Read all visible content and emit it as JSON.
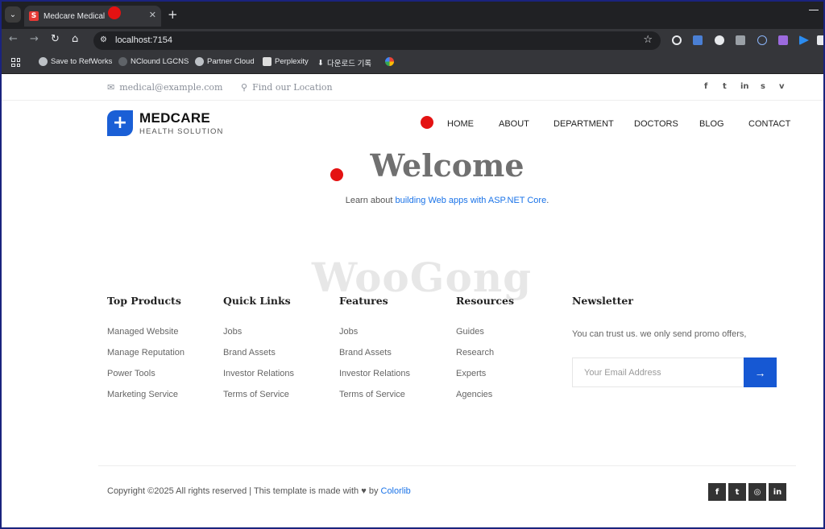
{
  "browser": {
    "tab_title": "Medcare Medical",
    "tab_close": "✕",
    "new_tab": "+",
    "url": "localhost:7154",
    "bookmarks": [
      "Save to RefWorks",
      "NClound LGCNS",
      "Partner Cloud",
      "Perplexity",
      "다운로드 기록"
    ]
  },
  "topbar": {
    "email": "medical@example.com",
    "location": "Find our Location",
    "social": [
      "f",
      "t",
      "in",
      "s",
      "v"
    ]
  },
  "brand": {
    "name": "MEDCARE",
    "tagline": "HEALTH SOLUTION",
    "accent": "#1a5fd6"
  },
  "nav": {
    "items": [
      "HOME",
      "ABOUT",
      "DEPARTMENT",
      "DOCTORS",
      "BLOG",
      "CONTACT"
    ]
  },
  "hero": {
    "title": "Welcome",
    "lead": "Learn about ",
    "link": "building Web apps with ASP.NET Core",
    "trail": "."
  },
  "watermark": "WooGong",
  "footer": {
    "columns": [
      {
        "heading": "Top Products",
        "links": [
          "Managed Website",
          "Manage Reputation",
          "Power Tools",
          "Marketing Service"
        ]
      },
      {
        "heading": "Quick Links",
        "links": [
          "Jobs",
          "Brand Assets",
          "Investor Relations",
          "Terms of Service"
        ]
      },
      {
        "heading": "Features",
        "links": [
          "Jobs",
          "Brand Assets",
          "Investor Relations",
          "Terms of Service"
        ]
      },
      {
        "heading": "Resources",
        "links": [
          "Guides",
          "Research",
          "Experts",
          "Agencies"
        ]
      }
    ],
    "newsletter": {
      "heading": "Newsletter",
      "text": "You can trust us. we only send promo offers,",
      "placeholder": "Your Email Address",
      "button": "→"
    },
    "copyright": "Copyright ©2025 All rights reserved | This template is made with ♥ by ",
    "copyright_link": "Colorlib",
    "social": [
      "f",
      "t",
      "◎",
      "in"
    ]
  }
}
